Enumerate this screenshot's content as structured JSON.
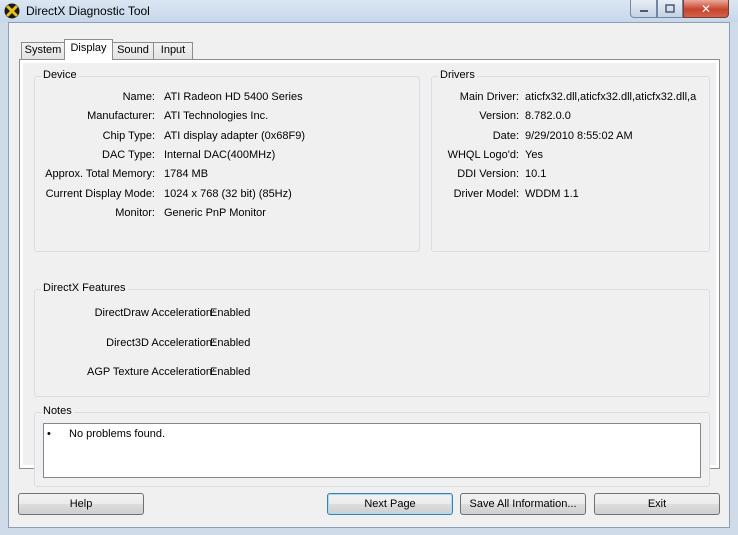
{
  "window": {
    "title": "DirectX Diagnostic Tool"
  },
  "tabs": [
    {
      "label": "System"
    },
    {
      "label": "Display"
    },
    {
      "label": "Sound"
    },
    {
      "label": "Input"
    }
  ],
  "device": {
    "title": "Device",
    "rows": [
      {
        "label": "Name:",
        "value": "ATI Radeon HD 5400 Series"
      },
      {
        "label": "Manufacturer:",
        "value": "ATI Technologies Inc."
      },
      {
        "label": "Chip Type:",
        "value": "ATI display adapter (0x68F9)"
      },
      {
        "label": "DAC Type:",
        "value": "Internal DAC(400MHz)"
      },
      {
        "label": "Approx. Total Memory:",
        "value": "1784 MB"
      },
      {
        "label": "Current Display Mode:",
        "value": "1024 x 768 (32 bit) (85Hz)"
      },
      {
        "label": "Monitor:",
        "value": "Generic PnP Monitor"
      }
    ]
  },
  "drivers": {
    "title": "Drivers",
    "rows": [
      {
        "label": "Main Driver:",
        "value": "aticfx32.dll,aticfx32.dll,aticfx32.dll,a"
      },
      {
        "label": "Version:",
        "value": "8.782.0.0"
      },
      {
        "label": "Date:",
        "value": "9/29/2010 8:55:02 AM"
      },
      {
        "label": "WHQL Logo'd:",
        "value": "Yes"
      },
      {
        "label": "DDI Version:",
        "value": "10.1"
      },
      {
        "label": "Driver Model:",
        "value": "WDDM 1.1"
      }
    ]
  },
  "features": {
    "title": "DirectX Features",
    "rows": [
      {
        "label": "DirectDraw Acceleration:",
        "value": "Enabled"
      },
      {
        "label": "Direct3D Acceleration:",
        "value": "Enabled"
      },
      {
        "label": "AGP Texture Acceleration:",
        "value": "Enabled"
      }
    ]
  },
  "notes": {
    "title": "Notes",
    "bullet": "•",
    "items": [
      "No problems found."
    ]
  },
  "buttons": {
    "help": "Help",
    "next_page": "Next Page",
    "save_all": "Save All Information...",
    "exit": "Exit"
  },
  "icons": {
    "app": "directx-x-icon",
    "minimize": "minimize-icon",
    "maximize": "maximize-icon",
    "close": "close-icon"
  },
  "colors": {
    "title_bar": "#c7d7ea",
    "close_button": "#c7442c",
    "panel": "#f0f0f0",
    "default_button_border": "#3c7fb1"
  }
}
